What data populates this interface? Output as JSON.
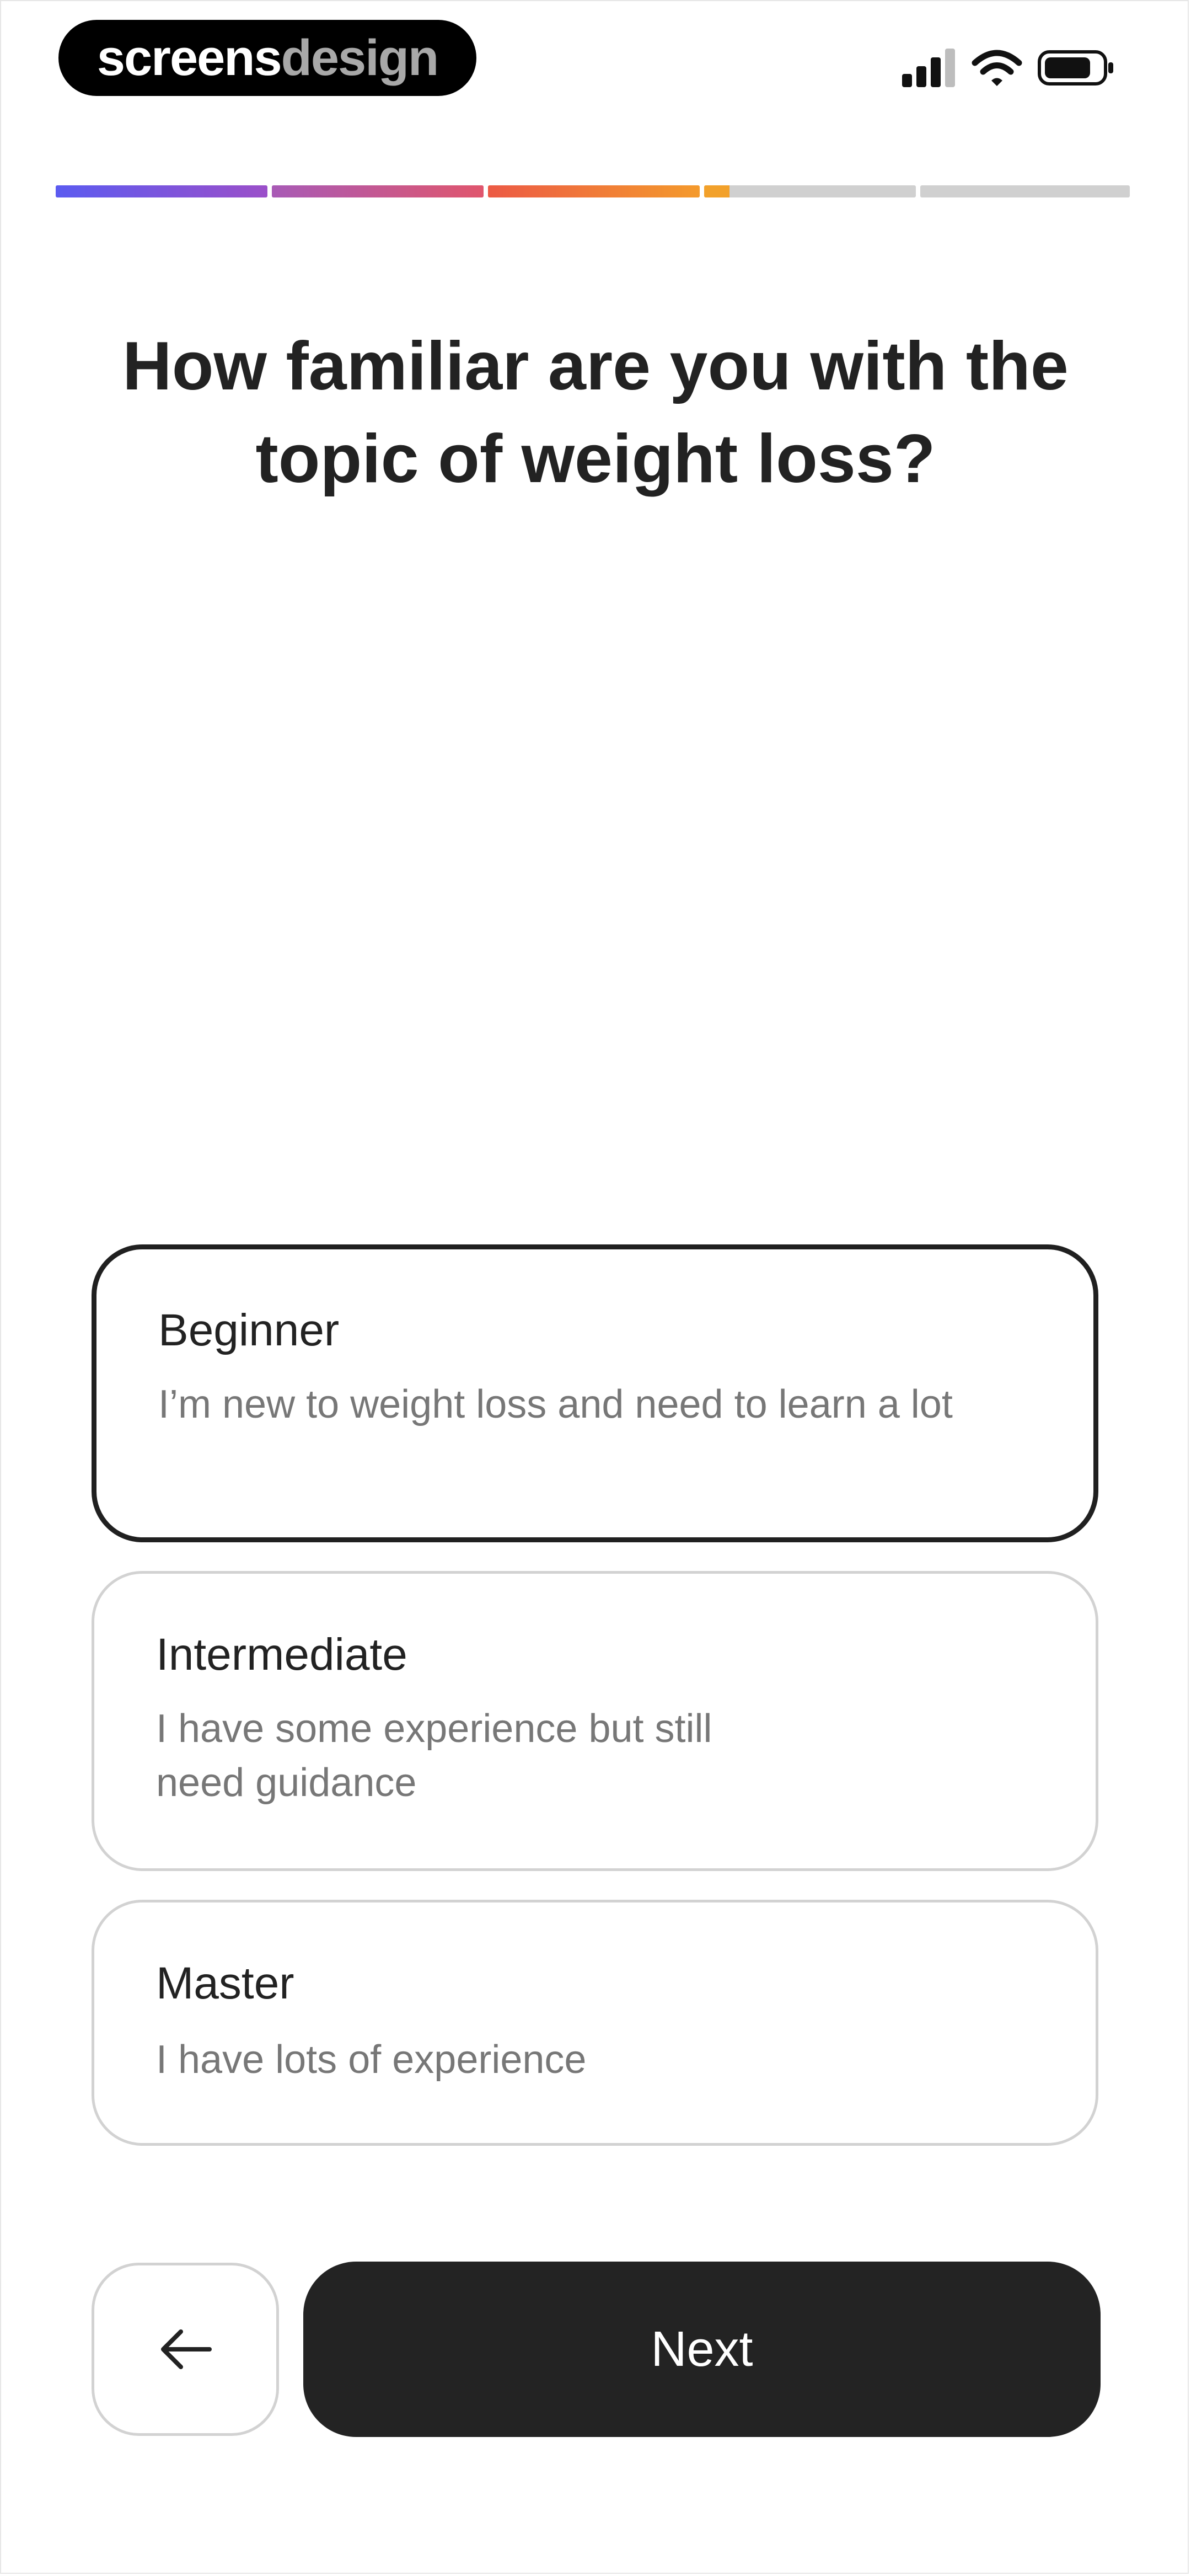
{
  "brand": {
    "part1": "screens",
    "part2": "design"
  },
  "status_bar": {
    "icons": [
      "signal-icon",
      "wifi-icon",
      "battery-icon"
    ]
  },
  "progress": {
    "segments": [
      {
        "fill": 1.0,
        "colors": [
          "#5b5bf0",
          "#9b4fc9"
        ]
      },
      {
        "fill": 1.0,
        "colors": [
          "#a85ab6",
          "#e0566d"
        ]
      },
      {
        "fill": 1.0,
        "colors": [
          "#ec5a45",
          "#f49a2c"
        ]
      },
      {
        "fill": 0.12,
        "colors": [
          "#f2a12b",
          "#f2a12b"
        ]
      },
      {
        "fill": 0.0,
        "colors": [
          "#d0d0d0",
          "#d0d0d0"
        ]
      }
    ],
    "track_color": "#d0d0d0"
  },
  "question": "How familiar are you with the topic of weight loss?",
  "options": [
    {
      "title": "Beginner",
      "description": "I’m new to weight loss and need to learn a lot",
      "selected": true
    },
    {
      "title": "Intermediate",
      "description": "I have some experience but still need guidance",
      "selected": false
    },
    {
      "title": "Master",
      "description": "I have lots of experience",
      "selected": false
    }
  ],
  "buttons": {
    "back_icon": "arrow-left-icon",
    "next_label": "Next"
  },
  "colors": {
    "primary_dark": "#232323",
    "border_light": "#d2d2d2",
    "text_muted": "#777777"
  }
}
